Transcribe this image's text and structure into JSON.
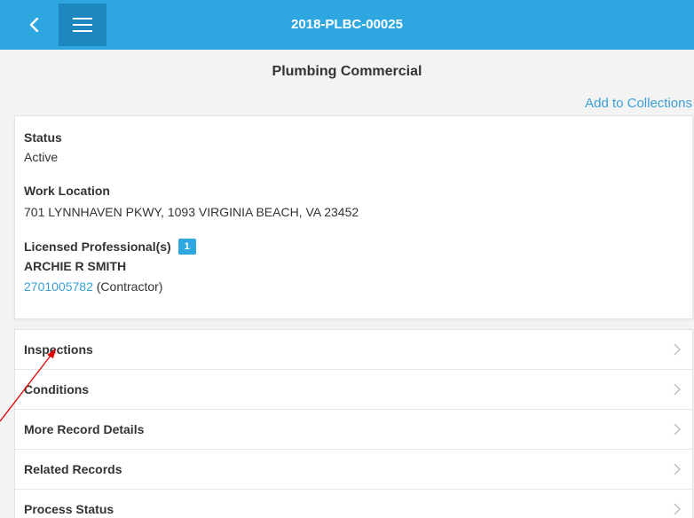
{
  "header": {
    "title": "2018-PLBC-00025",
    "back_icon": "chevron-left-icon",
    "menu_icon": "hamburger-menu-icon"
  },
  "subheader": {
    "title": "Plumbing Commercial"
  },
  "actions": {
    "add_to_collections": "Add to Collections"
  },
  "details": {
    "status_label": "Status",
    "status_value": "Active",
    "location_label": "Work Location",
    "location_value": "701 LYNNHAVEN PKWY, 1093 VIRGINIA BEACH, VA 23452",
    "lp_label": "Licensed Professional(s)",
    "lp_count": "1",
    "lp_name": "ARCHIE R SMITH",
    "lp_number": "2701005782",
    "lp_type": " (Contractor)"
  },
  "sections": [
    {
      "label": "Inspections"
    },
    {
      "label": "Conditions"
    },
    {
      "label": "More Record Details"
    },
    {
      "label": "Related Records"
    },
    {
      "label": "Process Status"
    }
  ],
  "colors": {
    "header_bg": "#2ea7e0",
    "menu_bg": "#1e86bf",
    "link": "#3b9fd6",
    "annotation_arrow": "#e00000"
  }
}
